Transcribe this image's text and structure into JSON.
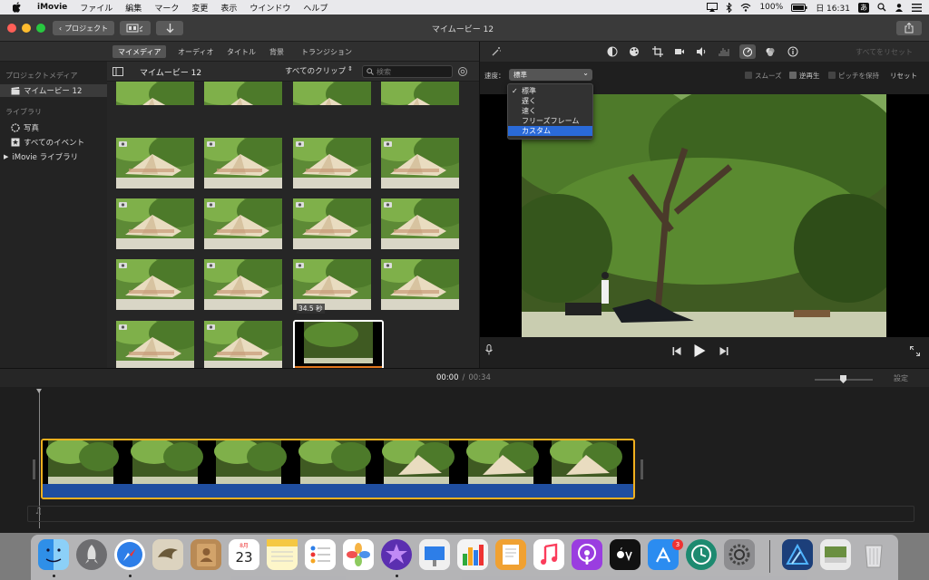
{
  "menubar": {
    "app": "iMovie",
    "items": [
      "ファイル",
      "編集",
      "マーク",
      "変更",
      "表示",
      "ウインドウ",
      "ヘルプ"
    ],
    "battery": "100%",
    "date": "日 16:31",
    "input_mode": "あ"
  },
  "window": {
    "title": "マイムービー 12",
    "back_label": "プロジェクト"
  },
  "browser_tabs": [
    "マイメディア",
    "オーディオ",
    "タイトル",
    "背景",
    "トランジション"
  ],
  "sidebar": {
    "project_media_header": "プロジェクトメディア",
    "project_item": "マイムービー 12",
    "library_header": "ライブラリ",
    "library_items": [
      "写真",
      "すべてのイベント",
      "iMovie ライブラリ"
    ]
  },
  "browser": {
    "title": "マイムービー 12",
    "filter": "すべてのクリップ",
    "search_placeholder": "検索",
    "selected_clip_duration": "34.5 秒"
  },
  "viewer": {
    "reset_all": "すべてをリセット",
    "speed_label": "速度：",
    "speed_value": "標準",
    "smooth": "スムーズ",
    "reverse": "逆再生",
    "keep_pitch": "ピッチを保持",
    "reset": "リセット",
    "speed_options": [
      "標準",
      "遅く",
      "速く",
      "フリーズフレーム",
      "カスタム"
    ],
    "speed_selected_index": 0,
    "speed_highlight_index": 4
  },
  "timeline": {
    "current_time": "00:00",
    "separator": "/",
    "total_time": "00:34",
    "settings": "設定"
  },
  "dock": {
    "appstore_badge": "3",
    "calendar_month": "8月",
    "calendar_day": "23"
  },
  "colors": {
    "accent": "#2a6ad8",
    "clip_border": "#f2b01e",
    "clip_bar": "#1f4ea0",
    "audio_orange": "#e0761e"
  }
}
